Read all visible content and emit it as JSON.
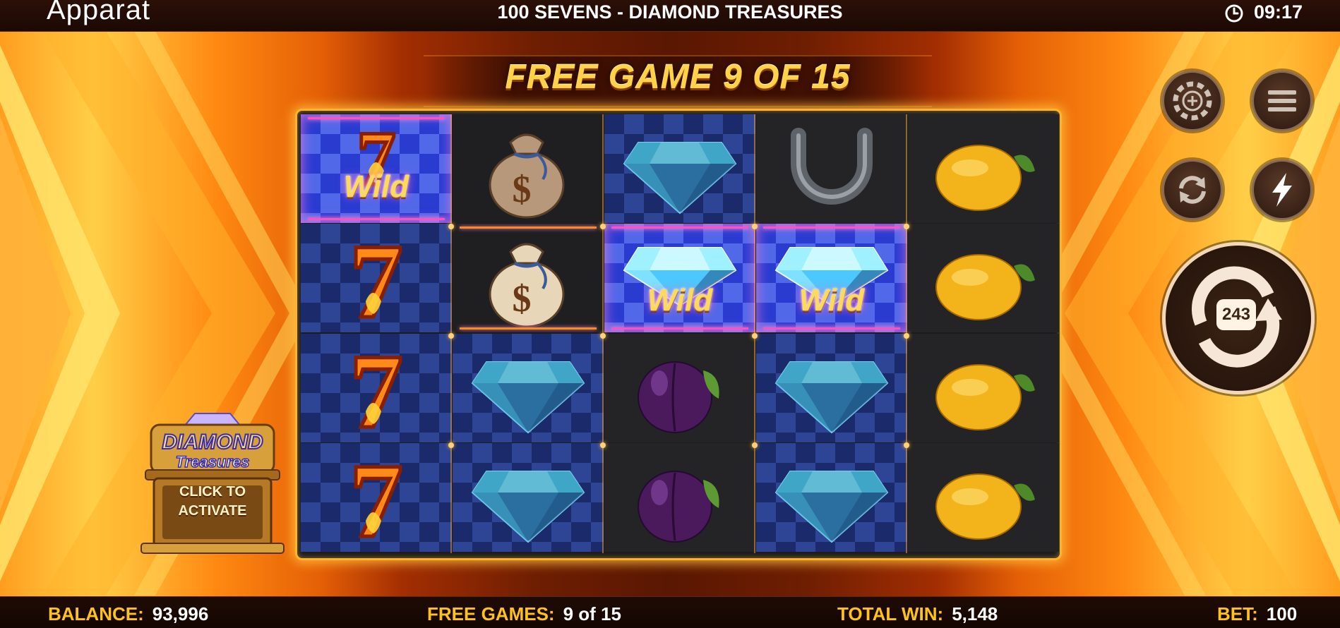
{
  "header": {
    "brand": "Apparat",
    "game_title": "100 SEVENS - DIAMOND TREASURES",
    "time": "09:17"
  },
  "banner": {
    "text": "FREE GAME 9 OF 15"
  },
  "reels": [
    [
      "wild-seven",
      "seven",
      "seven",
      "seven"
    ],
    [
      "money-bag",
      "money-bag-highlight",
      "diamond",
      "diamond"
    ],
    [
      "diamond",
      "wild-diamond",
      "plum",
      "plum"
    ],
    [
      "horseshoe",
      "wild-diamond",
      "diamond",
      "diamond"
    ],
    [
      "lemon",
      "lemon",
      "lemon",
      "lemon"
    ]
  ],
  "wild_label": "Wild",
  "controls": {
    "spin_count": "243",
    "icons": [
      "chip-icon",
      "menu-icon",
      "autoplay-icon",
      "turbo-icon",
      "spin-icon"
    ]
  },
  "feature": {
    "title_line1": "DIAMOND",
    "title_line2": "Treasures",
    "cta_line1": "CLICK TO",
    "cta_line2": "ACTIVATE"
  },
  "status": {
    "balance_label": "BALANCE:",
    "balance_value": "93,996",
    "free_games_label": "FREE GAMES:",
    "free_games_value": "9 of 15",
    "total_win_label": "TOTAL WIN:",
    "total_win_value": "5,148",
    "bet_label": "BET:",
    "bet_value": "100"
  }
}
